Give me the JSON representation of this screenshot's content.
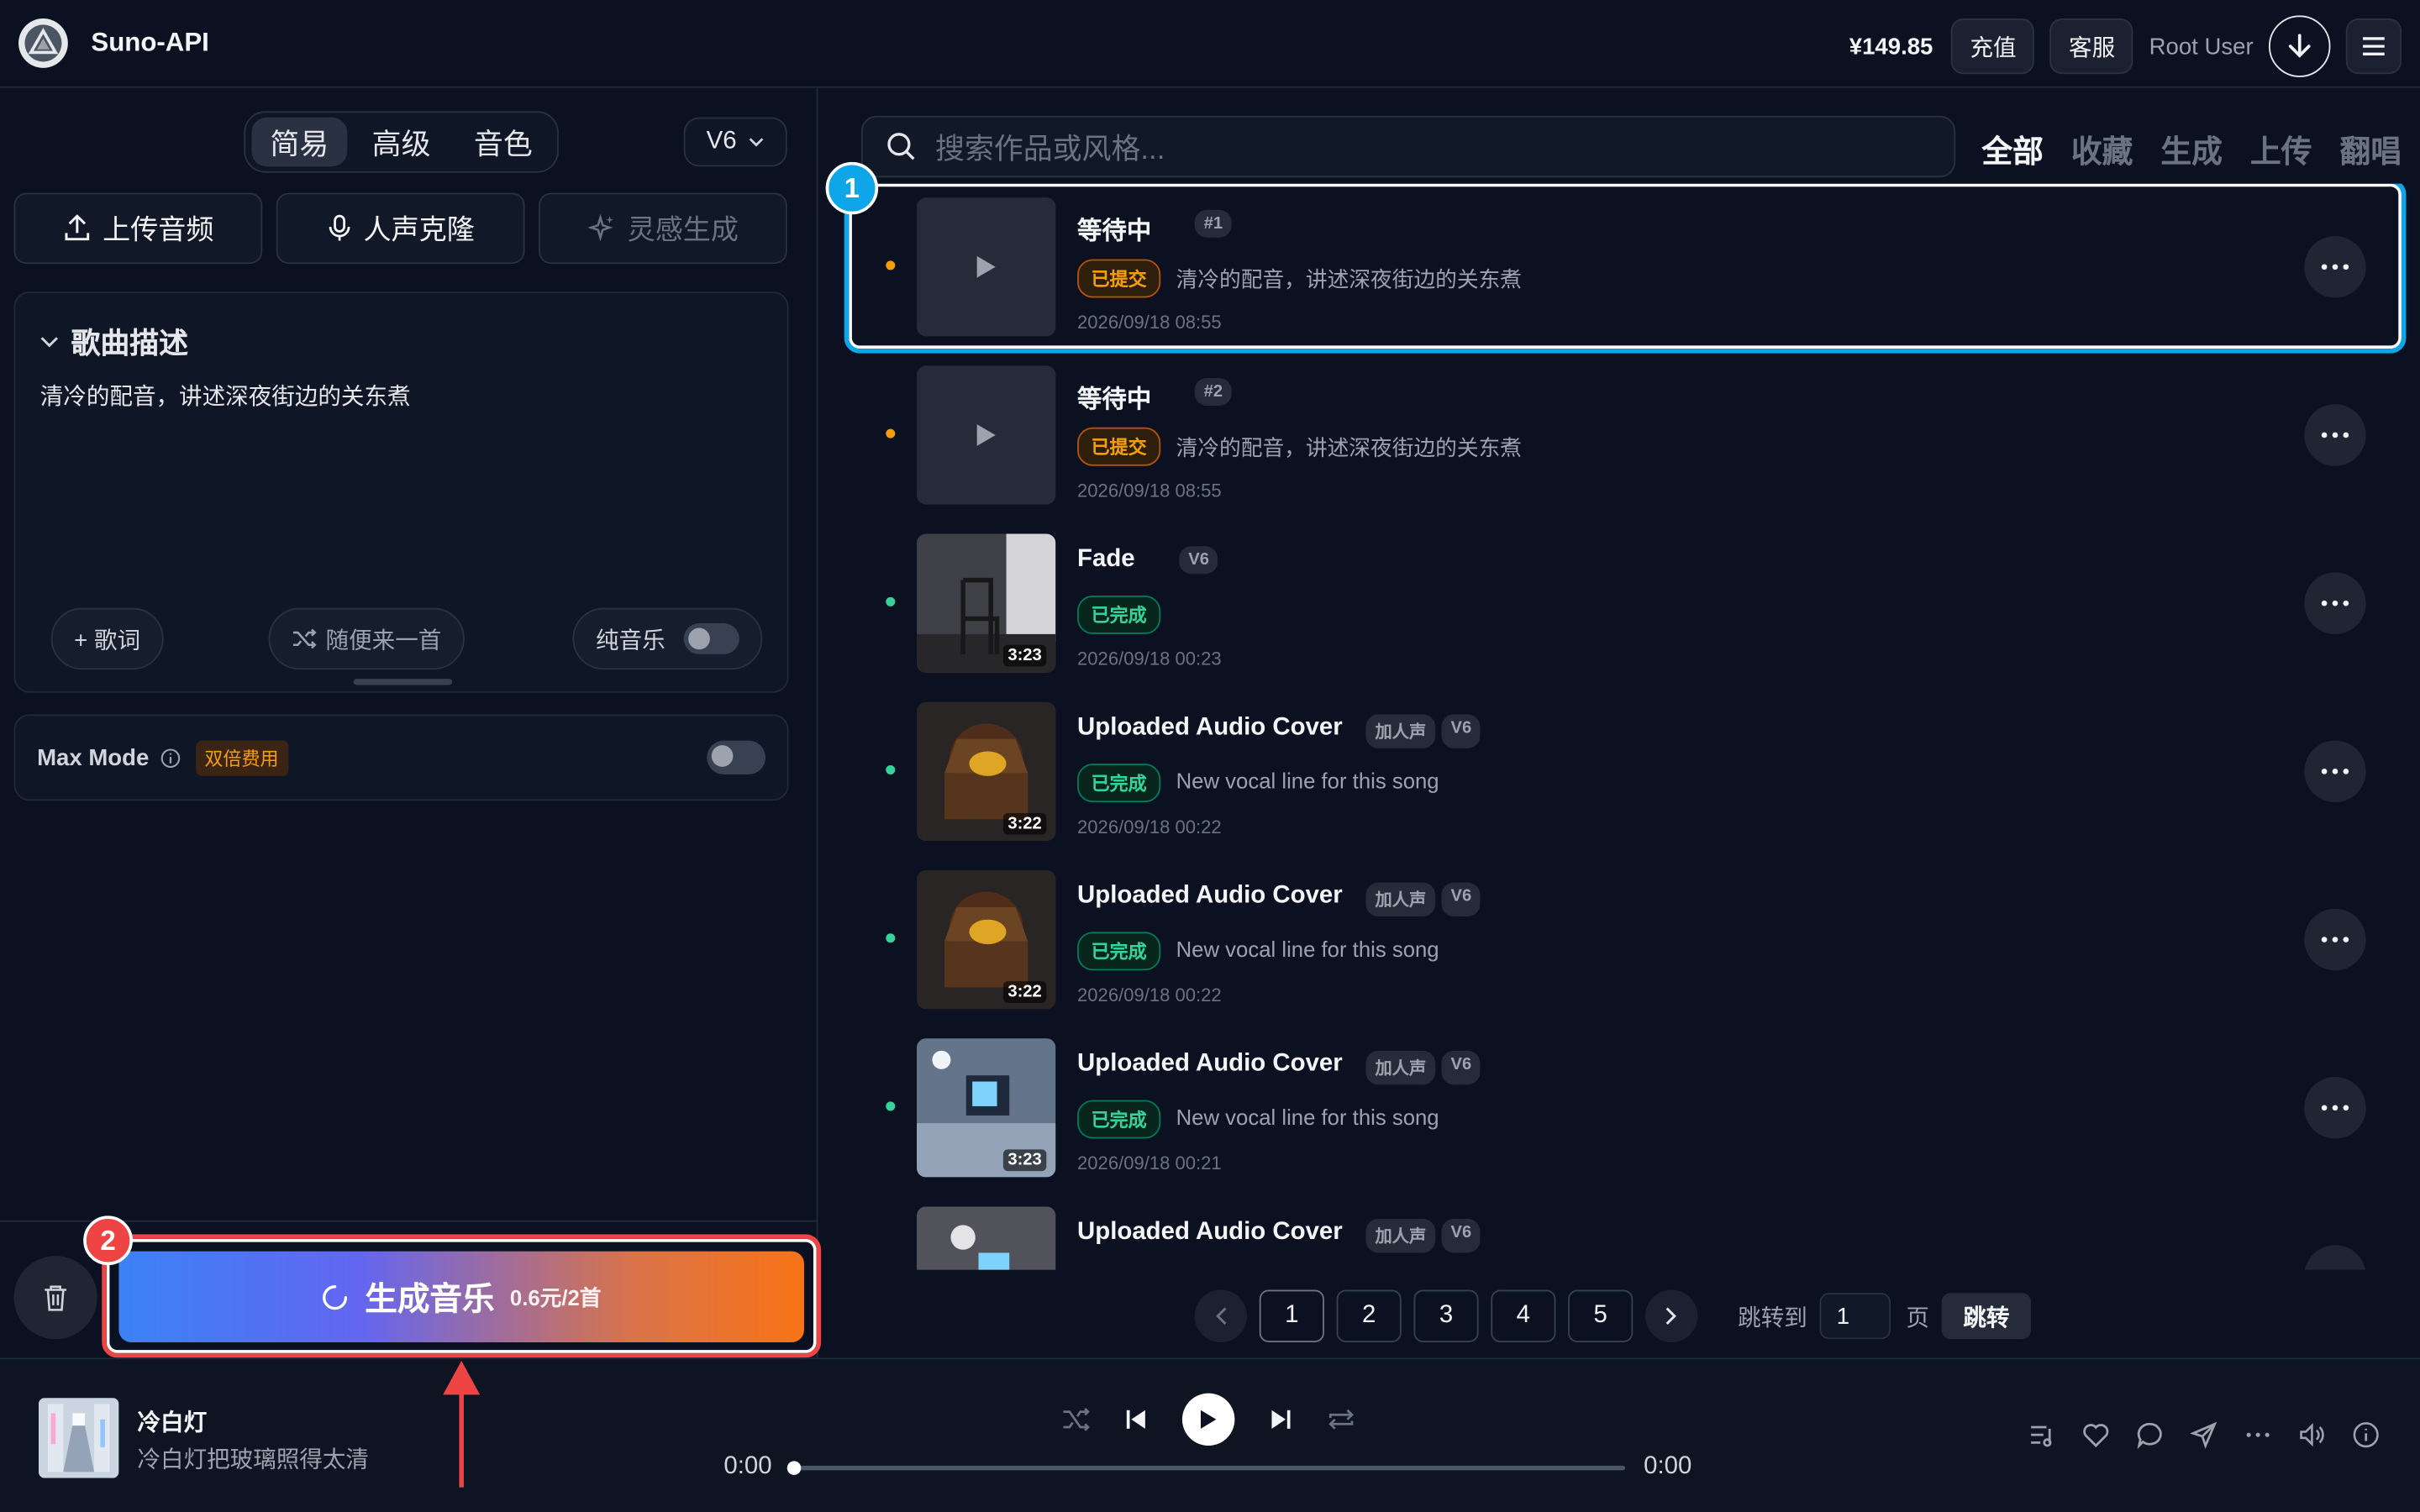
{
  "header": {
    "brand": "Suno-API",
    "balance": "¥149.85",
    "recharge": "充值",
    "support": "客服",
    "user": "Root User"
  },
  "left": {
    "mode_tabs": [
      "简易",
      "高级",
      "音色"
    ],
    "active_mode": "简易",
    "version": "V6",
    "actions": [
      "上传音频",
      "人声克隆",
      "灵感生成"
    ],
    "desc_title": "歌曲描述",
    "desc_text": "清冷的配音，讲述深夜街边的关东煮",
    "lyrics_btn": "+ 歌词",
    "random_btn": "随便来一首",
    "instrumental": "纯音乐",
    "max_mode": "Max Mode",
    "max_badge": "双倍费用",
    "generate_label": "生成音乐",
    "generate_price": "0.6元/2首",
    "badge_2": "2"
  },
  "right": {
    "search_placeholder": "搜索作品或风格...",
    "filters": [
      "全部",
      "收藏",
      "生成",
      "上传",
      "翻唱"
    ],
    "badge_1": "1",
    "songs": [
      {
        "title": "等待中",
        "tags": [
          "#1"
        ],
        "status": "已提交",
        "desc": "清冷的配音，讲述深夜街边的关东煮",
        "time": "2026/09/18 08:55",
        "duration": ""
      },
      {
        "title": "等待中",
        "tags": [
          "#2"
        ],
        "status": "已提交",
        "desc": "清冷的配音，讲述深夜街边的关东煮",
        "time": "2026/09/18 08:55",
        "duration": ""
      },
      {
        "title": "Fade",
        "tags": [
          "V6"
        ],
        "status": "已完成",
        "desc": "",
        "time": "2026/09/18 00:23",
        "duration": "3:23"
      },
      {
        "title": "Uploaded Audio Cover",
        "tags": [
          "加人声",
          "V6"
        ],
        "status": "已完成",
        "desc": "New vocal line for this song",
        "time": "2026/09/18 00:22",
        "duration": "3:22"
      },
      {
        "title": "Uploaded Audio Cover",
        "tags": [
          "加人声",
          "V6"
        ],
        "status": "已完成",
        "desc": "New vocal line for this song",
        "time": "2026/09/18 00:22",
        "duration": "3:22"
      },
      {
        "title": "Uploaded Audio Cover",
        "tags": [
          "加人声",
          "V6"
        ],
        "status": "已完成",
        "desc": "New vocal line for this song",
        "time": "2026/09/18 00:21",
        "duration": "3:23"
      },
      {
        "title": "Uploaded Audio Cover",
        "tags": [
          "加人声",
          "V6"
        ],
        "status": "",
        "desc": "",
        "time": "",
        "duration": ""
      }
    ],
    "pages": [
      "1",
      "2",
      "3",
      "4",
      "5"
    ],
    "jump_to": "跳转到",
    "jump_value": "1",
    "page_unit": "页",
    "jump_btn": "跳转"
  },
  "player": {
    "title": "冷白灯",
    "subtitle": "冷白灯把玻璃照得太清",
    "time_current": "0:00",
    "time_total": "0:00",
    "progress": 0
  },
  "colors": {
    "accent_blue": "#0ea5e9",
    "highlight_red": "#ef4444",
    "pending": "#f59e0b",
    "done": "#34d399"
  }
}
